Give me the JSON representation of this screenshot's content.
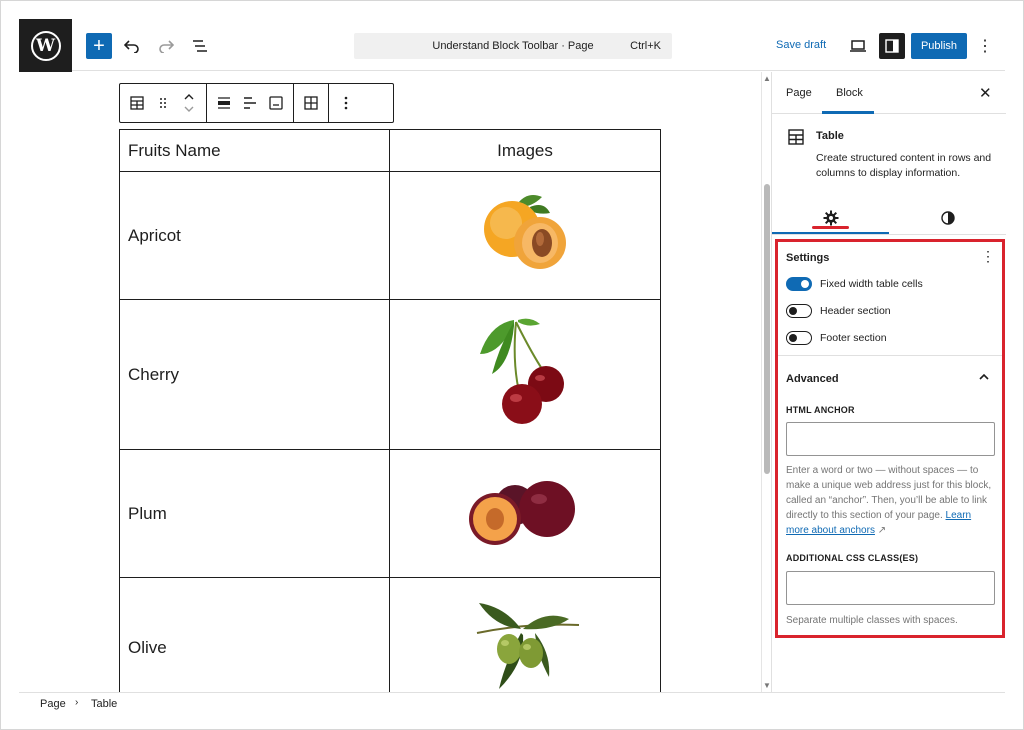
{
  "header": {
    "document_title": "Understand Block Toolbar · Page",
    "shortcut": "Ctrl+K",
    "save_draft_label": "Save draft",
    "publish_label": "Publish",
    "accent_color": "#0f6ab4"
  },
  "table_block": {
    "headers": [
      "Fruits Name",
      "Images"
    ],
    "rows": [
      {
        "name": "Apricot",
        "image": "apricot-image"
      },
      {
        "name": "Cherry",
        "image": "cherry-image"
      },
      {
        "name": "Plum",
        "image": "plum-image"
      },
      {
        "name": "Olive",
        "image": "olive-image"
      }
    ]
  },
  "sidebar": {
    "tabs": [
      "Page",
      "Block"
    ],
    "active_tab": "Block",
    "block_card": {
      "title": "Table",
      "description": "Create structured content in rows and columns to display information."
    },
    "settings": {
      "title": "Settings",
      "toggles": [
        {
          "label": "Fixed width table cells",
          "on": true
        },
        {
          "label": "Header section",
          "on": false
        },
        {
          "label": "Footer section",
          "on": false
        }
      ]
    },
    "advanced": {
      "title": "Advanced",
      "html_anchor_label": "HTML ANCHOR",
      "html_anchor_value": "",
      "html_anchor_help": "Enter a word or two — without spaces — to make a unique web address just for this block, called an “anchor”. Then, you’ll be able to link directly to this section of your page.",
      "learn_more_link": "Learn more about anchors",
      "css_class_label": "ADDITIONAL CSS CLASS(ES)",
      "css_class_value": "",
      "css_class_help": "Separate multiple classes with spaces."
    },
    "highlight_color": "#d9232d"
  },
  "breadcrumb": [
    "Page",
    "Table"
  ]
}
